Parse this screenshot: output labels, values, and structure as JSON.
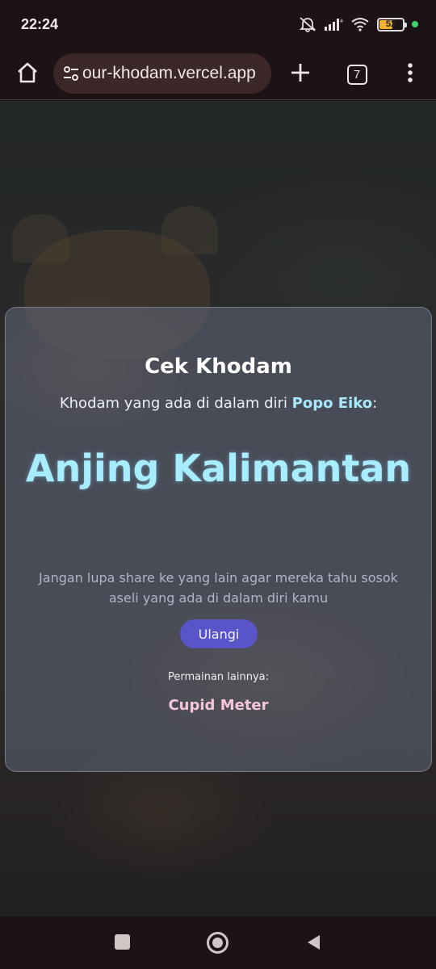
{
  "status_bar": {
    "time": "22:24",
    "battery_level": "52",
    "battery_fraction": 0.52,
    "icons": [
      "mute-bell-icon",
      "signal-icon",
      "wifi-icon",
      "battery-icon",
      "green-dot-indicator"
    ]
  },
  "browser": {
    "url": "our-khodam.vercel.app",
    "tab_count": "7",
    "icons": [
      "home-icon",
      "site-settings-icon",
      "plus-icon",
      "tabs-icon",
      "more-vert-icon"
    ]
  },
  "card": {
    "title": "Cek Khodam",
    "subtitle_prefix": "Khodam yang ada di dalam diri ",
    "name": "Popo Eiko",
    "subtitle_suffix": ":",
    "result": "Anjing Kalimantan",
    "share_note": "Jangan lupa share ke yang lain agar mereka tahu sosok aseli yang ada di dalam diri kamu",
    "retry_label": "Ulangi",
    "other_games_label": "Permainan lainnya:",
    "other_game_link": "Cupid Meter"
  },
  "colors": {
    "accent_button": "#5a54cb",
    "result_text": "#a8ecff",
    "name_text": "#a8e8ff",
    "link_text": "#f6c5dc",
    "chrome_bg": "#1d1214"
  },
  "navbar": {
    "icons": [
      "recents-icon",
      "home-circle-icon",
      "back-triangle-icon"
    ]
  }
}
